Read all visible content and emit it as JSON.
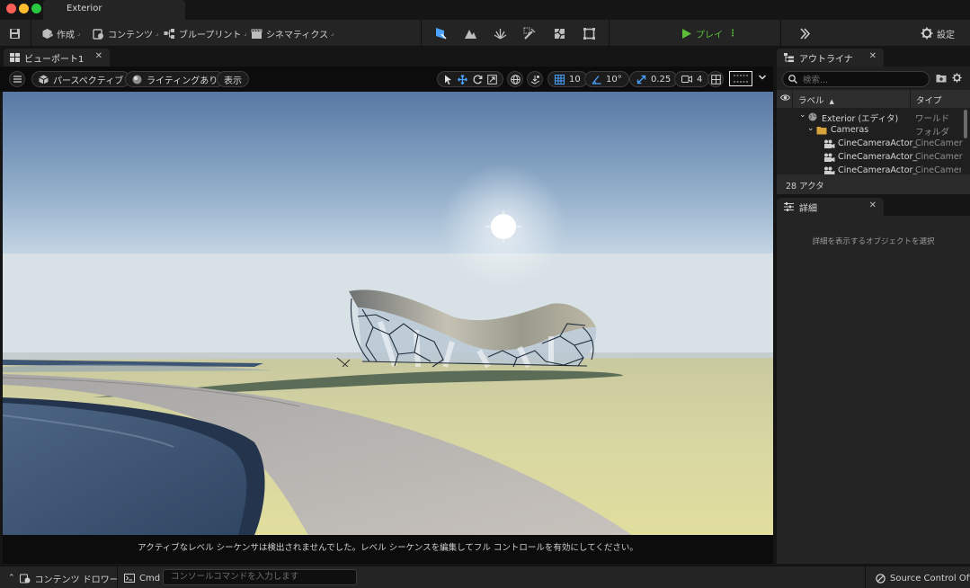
{
  "window": {
    "title": "Exterior",
    "traffic_lights": {
      "close": "#ff5f57",
      "minimize": "#febc2e",
      "maximize": "#28c840"
    }
  },
  "toolbar": {
    "create_label": "作成",
    "content_label": "コンテンツ",
    "blueprint_label": "ブループリント",
    "cinematics_label": "シネマティクス",
    "play_label": "プレイ",
    "settings_label": "設定",
    "accent_color": "#4aa3ff",
    "play_color": "#5bbd3a"
  },
  "viewport": {
    "tab_label": "ビューポート1",
    "view_mode_label": "パースペクティブ",
    "lighting_label": "ライティングあり",
    "show_label": "表示",
    "grid_snap_value": "10",
    "rotation_snap_value": "10°",
    "scale_snap_value": "0.25",
    "camera_speed_value": "4",
    "message": "アクティブなレベル シーケンサは検出されませんでした。レベル シーケンスを編集してフル コントロールを有効にしてください。"
  },
  "outliner": {
    "tab_label": "アウトライナ",
    "search_placeholder": "検索...",
    "col_label": "ラベル",
    "col_type": "タイプ",
    "rows": [
      {
        "label": "Exterior (エディタ)",
        "type": "ワールド"
      },
      {
        "label": "Cameras",
        "type": "フォルダ"
      },
      {
        "label": "CineCameraActor_",
        "type": "CineCamer"
      },
      {
        "label": "CineCameraActor_",
        "type": "CineCamer"
      },
      {
        "label": "CineCameraActor_",
        "type": "CineCamer"
      }
    ],
    "actor_count": "28 アクタ"
  },
  "details": {
    "tab_label": "詳細",
    "empty_message": "詳細を表示するオブジェクトを選択"
  },
  "statusbar": {
    "content_drawer_label": "コンテンツ ドロワー",
    "cmd_label": "Cmd",
    "console_placeholder": "コンソールコマンドを入力します",
    "source_control_label": "Source Control Off"
  }
}
